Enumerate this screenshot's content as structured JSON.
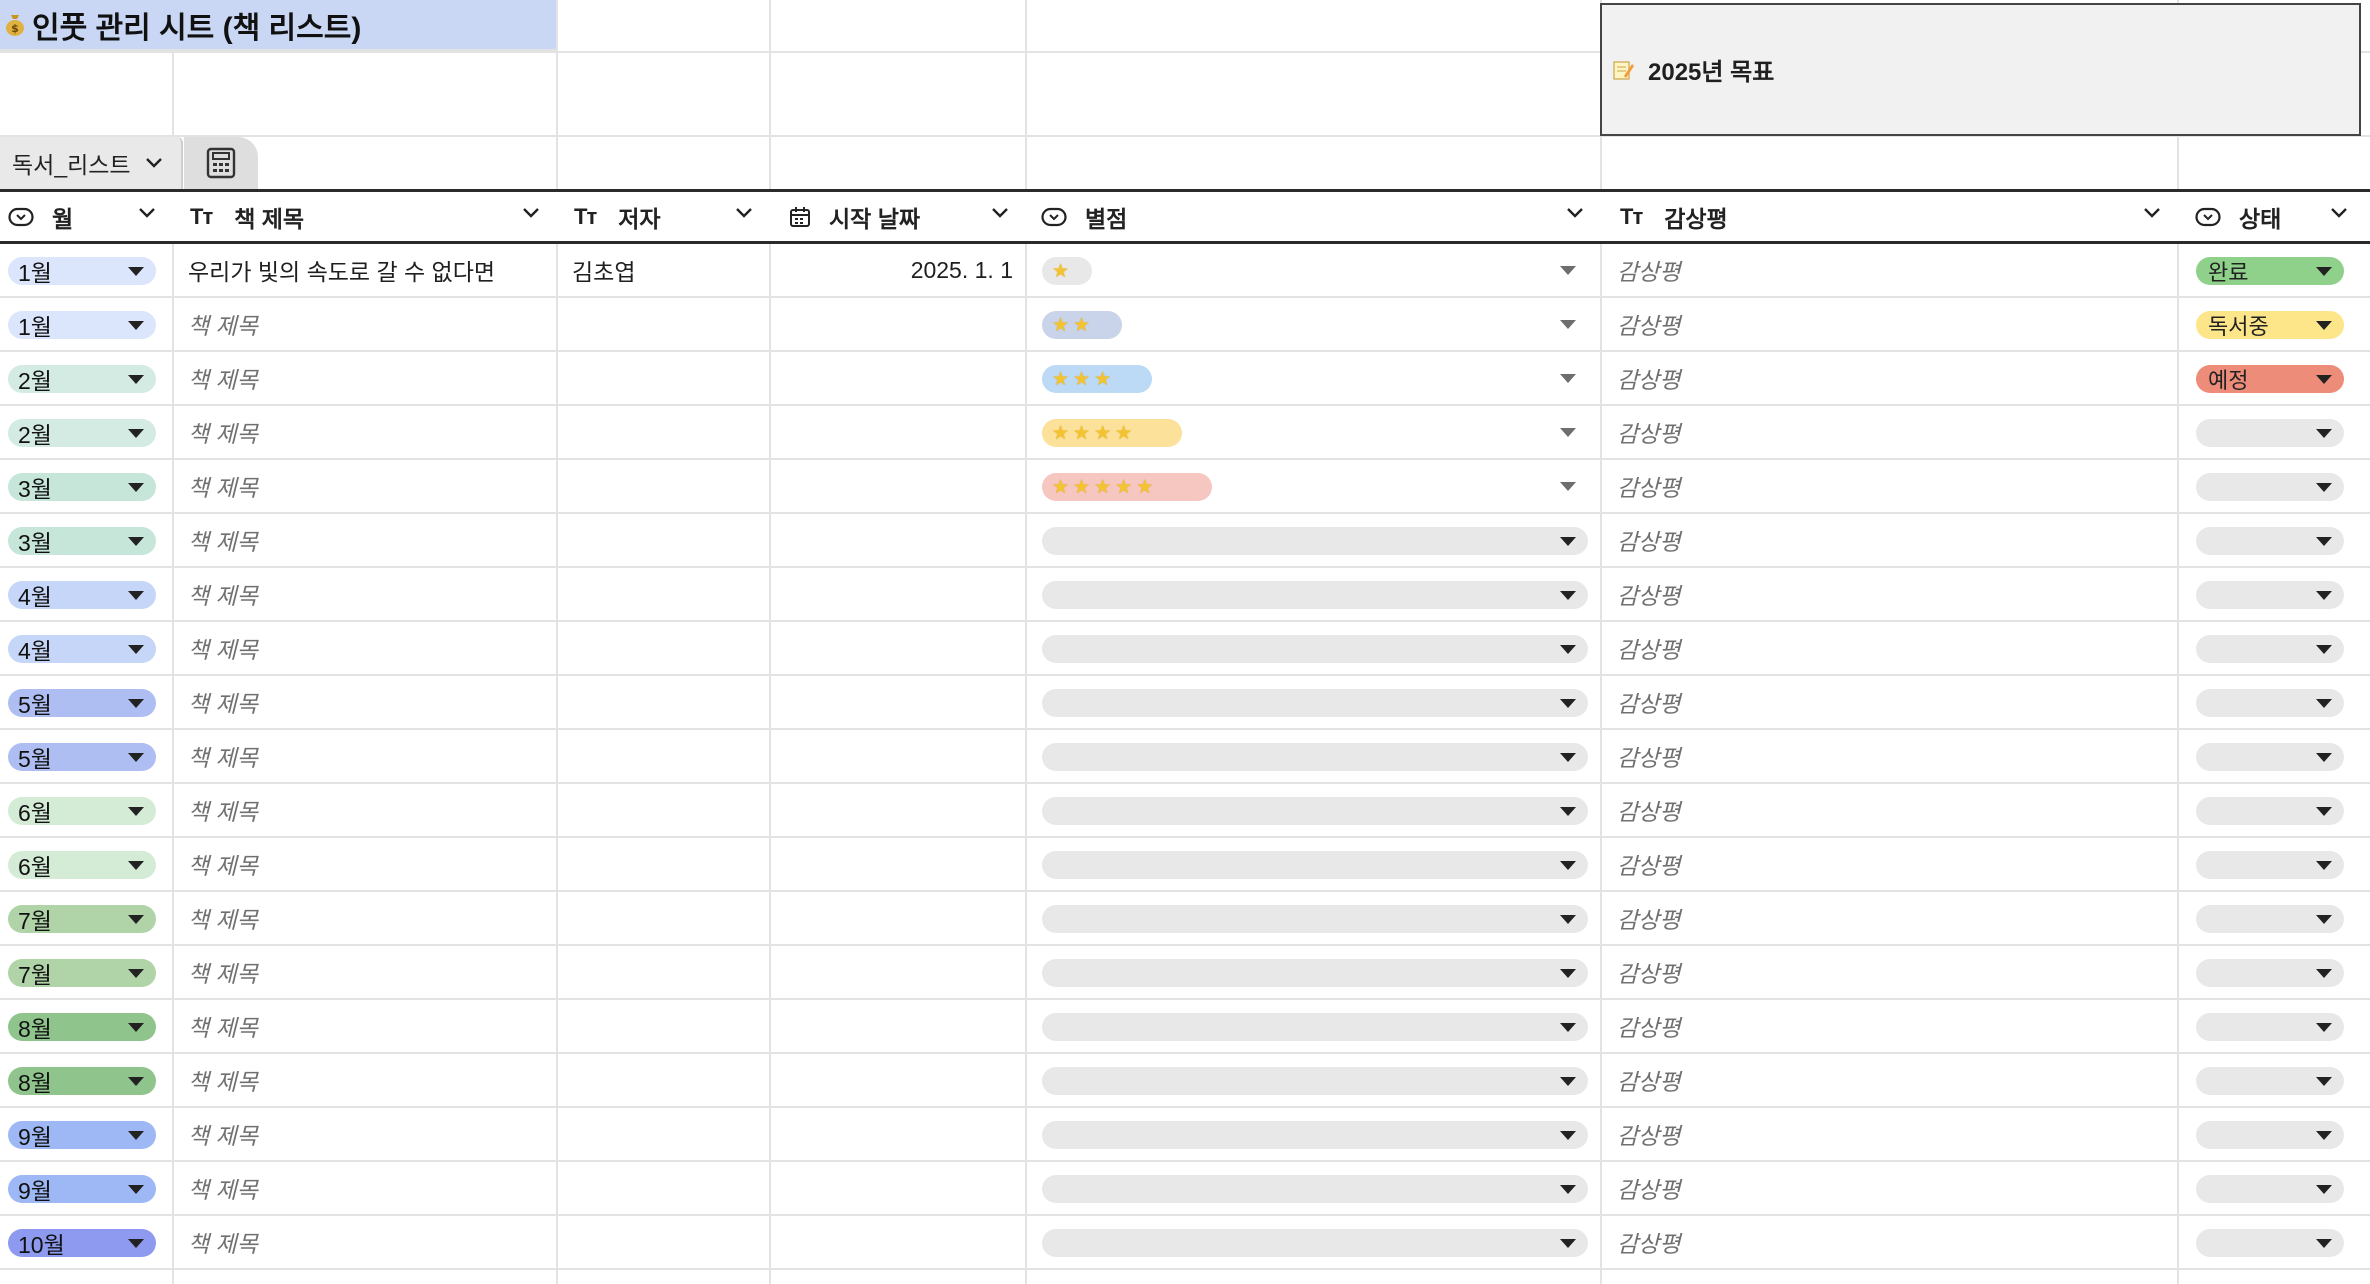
{
  "sheet": {
    "title": "인풋 관리 시트 (책 리스트)",
    "goal_label": "2025년 목표",
    "tab_name": "독서_리스트"
  },
  "columns": {
    "month": "월",
    "title": "책 제목",
    "author": "저자",
    "start_date": "시작 날짜",
    "rating": "별점",
    "review": "감상평",
    "status": "상태"
  },
  "placeholders": {
    "title": "책 제목",
    "review": "감상평"
  },
  "month_colors": {
    "1월": "#dbe5fb",
    "2월": "#d3ebe3",
    "3월": "#c6e6da",
    "4월": "#c6d6f8",
    "5월": "#aebef2",
    "6월": "#d4ecd5",
    "7월": "#b0d4a8",
    "8월": "#8fc58c",
    "9월": "#9db8f5",
    "10월": "#8d9aef"
  },
  "status_colors": {
    "완료": "#8fd18a",
    "독서중": "#fde68a",
    "예정": "#ee8c7a",
    "": "#e8e8e8"
  },
  "rating_colors": [
    "#e8e8e8",
    "#c9d4ea",
    "#bcd9f5",
    "#fbe199",
    "#f6c6c0"
  ],
  "rows": [
    {
      "month": "1월",
      "title": "우리가 빛의 속도로 갈 수 없다면",
      "author": "김초엽",
      "start_date": "2025. 1. 1",
      "rating": 1,
      "status": "완료"
    },
    {
      "month": "1월",
      "title": "",
      "author": "",
      "start_date": "",
      "rating": 2,
      "status": "독서중"
    },
    {
      "month": "2월",
      "title": "",
      "author": "",
      "start_date": "",
      "rating": 3,
      "status": "예정"
    },
    {
      "month": "2월",
      "title": "",
      "author": "",
      "start_date": "",
      "rating": 4,
      "status": ""
    },
    {
      "month": "3월",
      "title": "",
      "author": "",
      "start_date": "",
      "rating": 5,
      "status": ""
    },
    {
      "month": "3월",
      "title": "",
      "author": "",
      "start_date": "",
      "rating": 0,
      "status": ""
    },
    {
      "month": "4월",
      "title": "",
      "author": "",
      "start_date": "",
      "rating": 0,
      "status": ""
    },
    {
      "month": "4월",
      "title": "",
      "author": "",
      "start_date": "",
      "rating": 0,
      "status": ""
    },
    {
      "month": "5월",
      "title": "",
      "author": "",
      "start_date": "",
      "rating": 0,
      "status": ""
    },
    {
      "month": "5월",
      "title": "",
      "author": "",
      "start_date": "",
      "rating": 0,
      "status": ""
    },
    {
      "month": "6월",
      "title": "",
      "author": "",
      "start_date": "",
      "rating": 0,
      "status": ""
    },
    {
      "month": "6월",
      "title": "",
      "author": "",
      "start_date": "",
      "rating": 0,
      "status": ""
    },
    {
      "month": "7월",
      "title": "",
      "author": "",
      "start_date": "",
      "rating": 0,
      "status": ""
    },
    {
      "month": "7월",
      "title": "",
      "author": "",
      "start_date": "",
      "rating": 0,
      "status": ""
    },
    {
      "month": "8월",
      "title": "",
      "author": "",
      "start_date": "",
      "rating": 0,
      "status": ""
    },
    {
      "month": "8월",
      "title": "",
      "author": "",
      "start_date": "",
      "rating": 0,
      "status": ""
    },
    {
      "month": "9월",
      "title": "",
      "author": "",
      "start_date": "",
      "rating": 0,
      "status": ""
    },
    {
      "month": "9월",
      "title": "",
      "author": "",
      "start_date": "",
      "rating": 0,
      "status": ""
    },
    {
      "month": "10월",
      "title": "",
      "author": "",
      "start_date": "",
      "rating": 0,
      "status": ""
    }
  ],
  "icons": {
    "title": "money-bag-icon",
    "goal": "memo-icon",
    "tab_extra": "calculator-icon",
    "dropdown_column": "dropdown-column-icon",
    "text_column": "text-column-icon",
    "date_column": "calendar-icon"
  }
}
